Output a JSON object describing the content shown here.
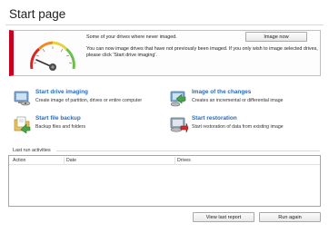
{
  "page": {
    "title": "Start page"
  },
  "alert": {
    "heading": "Some of your drives where never imaged.",
    "body": "You can now image drives that have not previously been imaged. If you only wish to image selected drives, please click 'Start drive imaging'.",
    "image_now_label": "Image now",
    "accent_color": "#c8001e"
  },
  "tasks": [
    {
      "title": "Start drive imaging",
      "description": "Create image of partition, drives or entire computer",
      "icon": "drive-imaging-icon"
    },
    {
      "title": "Image of the changes",
      "description": "Creates an incremental or differential image",
      "icon": "incremental-image-icon"
    },
    {
      "title": "Start file backup",
      "description": "Backup files and folders",
      "icon": "file-backup-icon"
    },
    {
      "title": "Start restoration",
      "description": "Start restoration of data from existing image",
      "icon": "restoration-icon"
    }
  ],
  "activities": {
    "section_label": "Last run activities",
    "columns": [
      "Action",
      "Date",
      "Drives"
    ],
    "rows": []
  },
  "footer": {
    "view_log_label": "View last report",
    "run_again_label": "Run again"
  }
}
